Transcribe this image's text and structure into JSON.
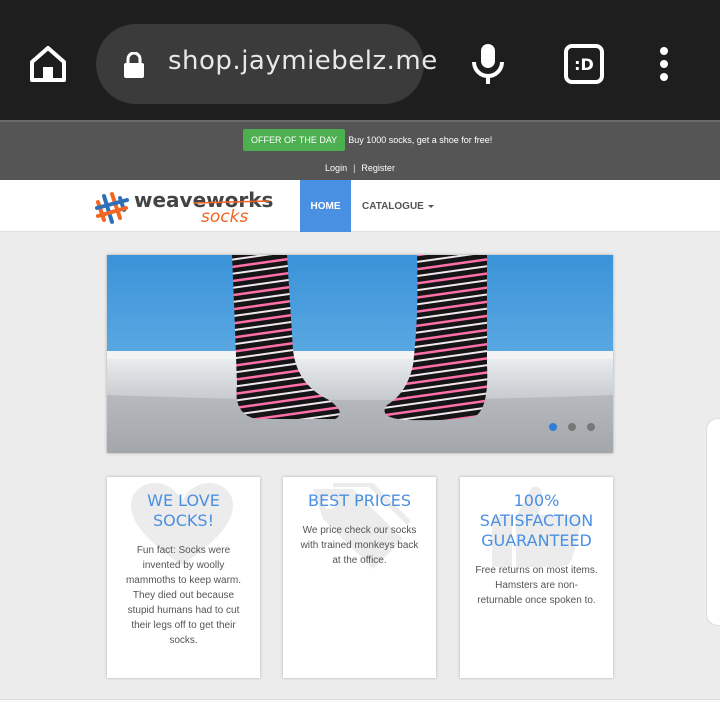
{
  "browser": {
    "url": "shop.jaymiebelz.me",
    "extension_label": ":D",
    "icons": [
      "home-icon",
      "lock-icon",
      "mic-icon",
      "extension-icon",
      "more-vert-icon"
    ]
  },
  "topbar": {
    "offer_badge": "OFFER OF THE DAY",
    "offer_text": "Buy 1000 socks, get a shoe for free!",
    "login": "Login",
    "separator": "|",
    "register": "Register"
  },
  "nav": {
    "logo_main": "weaveworks",
    "logo_sub": "socks",
    "home": "HOME",
    "catalogue": "CATALOGUE"
  },
  "carousel": {
    "slides": 3,
    "active_slide": 1
  },
  "features": [
    {
      "title": "WE LOVE SOCKS!",
      "text": "Fun fact: Socks were invented by woolly mammoths to keep warm. They died out because stupid humans had to cut their legs off to get their socks."
    },
    {
      "title": "BEST PRICES",
      "text": "We price check our socks with trained monkeys back at the office."
    },
    {
      "title": "100% SATISFACTION GUARANTEED",
      "text": "Free returns on most items. Hamsters are non-returnable once spoken to."
    }
  ],
  "colors": {
    "accent": "#4a90e2",
    "offer": "#4caf50",
    "logo_orange": "#f26522"
  }
}
